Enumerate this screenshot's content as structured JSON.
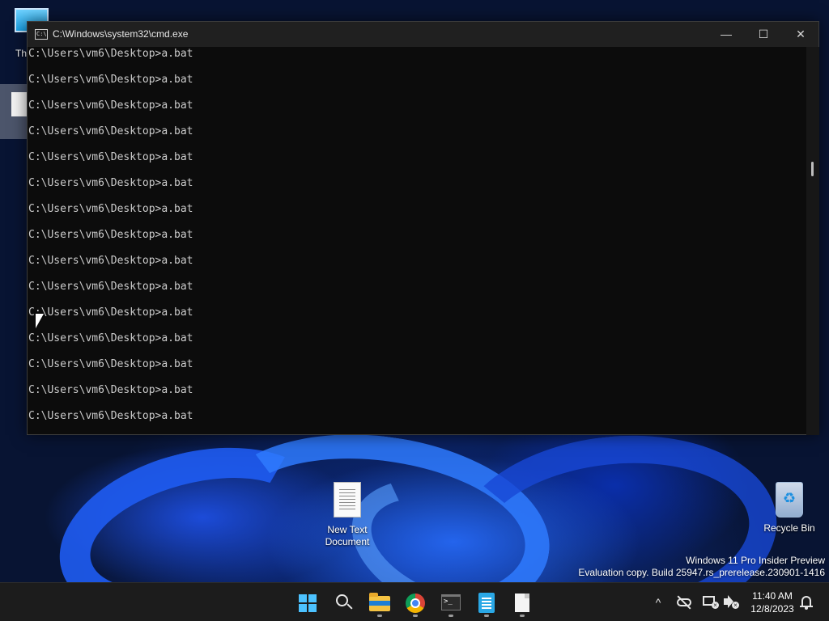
{
  "desktop": {
    "icons": {
      "this_pc_label": "Th",
      "new_text_document_label_1": "New Text",
      "new_text_document_label_2": "Document",
      "recycle_bin_label": "Recycle Bin"
    },
    "watermark": {
      "line1": "Windows 11 Pro Insider Preview",
      "line2": "Evaluation copy. Build 25947.rs_prerelease.230901-1416"
    }
  },
  "cmd_window": {
    "title": "C:\\Windows\\system32\\cmd.exe",
    "lines": [
      "C:\\Users\\vm6\\Desktop>a.bat",
      "C:\\Users\\vm6\\Desktop>a.bat",
      "C:\\Users\\vm6\\Desktop>a.bat",
      "C:\\Users\\vm6\\Desktop>a.bat",
      "C:\\Users\\vm6\\Desktop>a.bat",
      "C:\\Users\\vm6\\Desktop>a.bat",
      "C:\\Users\\vm6\\Desktop>a.bat",
      "C:\\Users\\vm6\\Desktop>a.bat",
      "C:\\Users\\vm6\\Desktop>a.bat",
      "C:\\Users\\vm6\\Desktop>a.bat",
      "C:\\Users\\vm6\\Desktop>a.bat",
      "C:\\Users\\vm6\\Desktop>a.bat",
      "C:\\Users\\vm6\\Desktop>a.bat",
      "C:\\Users\\vm6\\Desktop>a.bat",
      "C:\\Users\\vm6\\Desktop>a.bat"
    ],
    "buttons": {
      "minimize": "—",
      "maximize": "☐",
      "close": "✕"
    }
  },
  "taskbar": {
    "apps": [
      "start-icon",
      "search-icon",
      "file-explorer-icon",
      "chrome-icon",
      "terminal-icon",
      "notepad-icon",
      "text-file-icon"
    ],
    "tray": {
      "chevron": "^",
      "clock_time": "11:40 AM",
      "clock_date": "12/8/2023"
    }
  },
  "colors": {
    "console_bg": "#0c0c0c",
    "console_text": "#cccccc",
    "titlebar_bg": "#202020",
    "taskbar_bg": "#1c1c1c",
    "accent": "#4cc2ff"
  }
}
